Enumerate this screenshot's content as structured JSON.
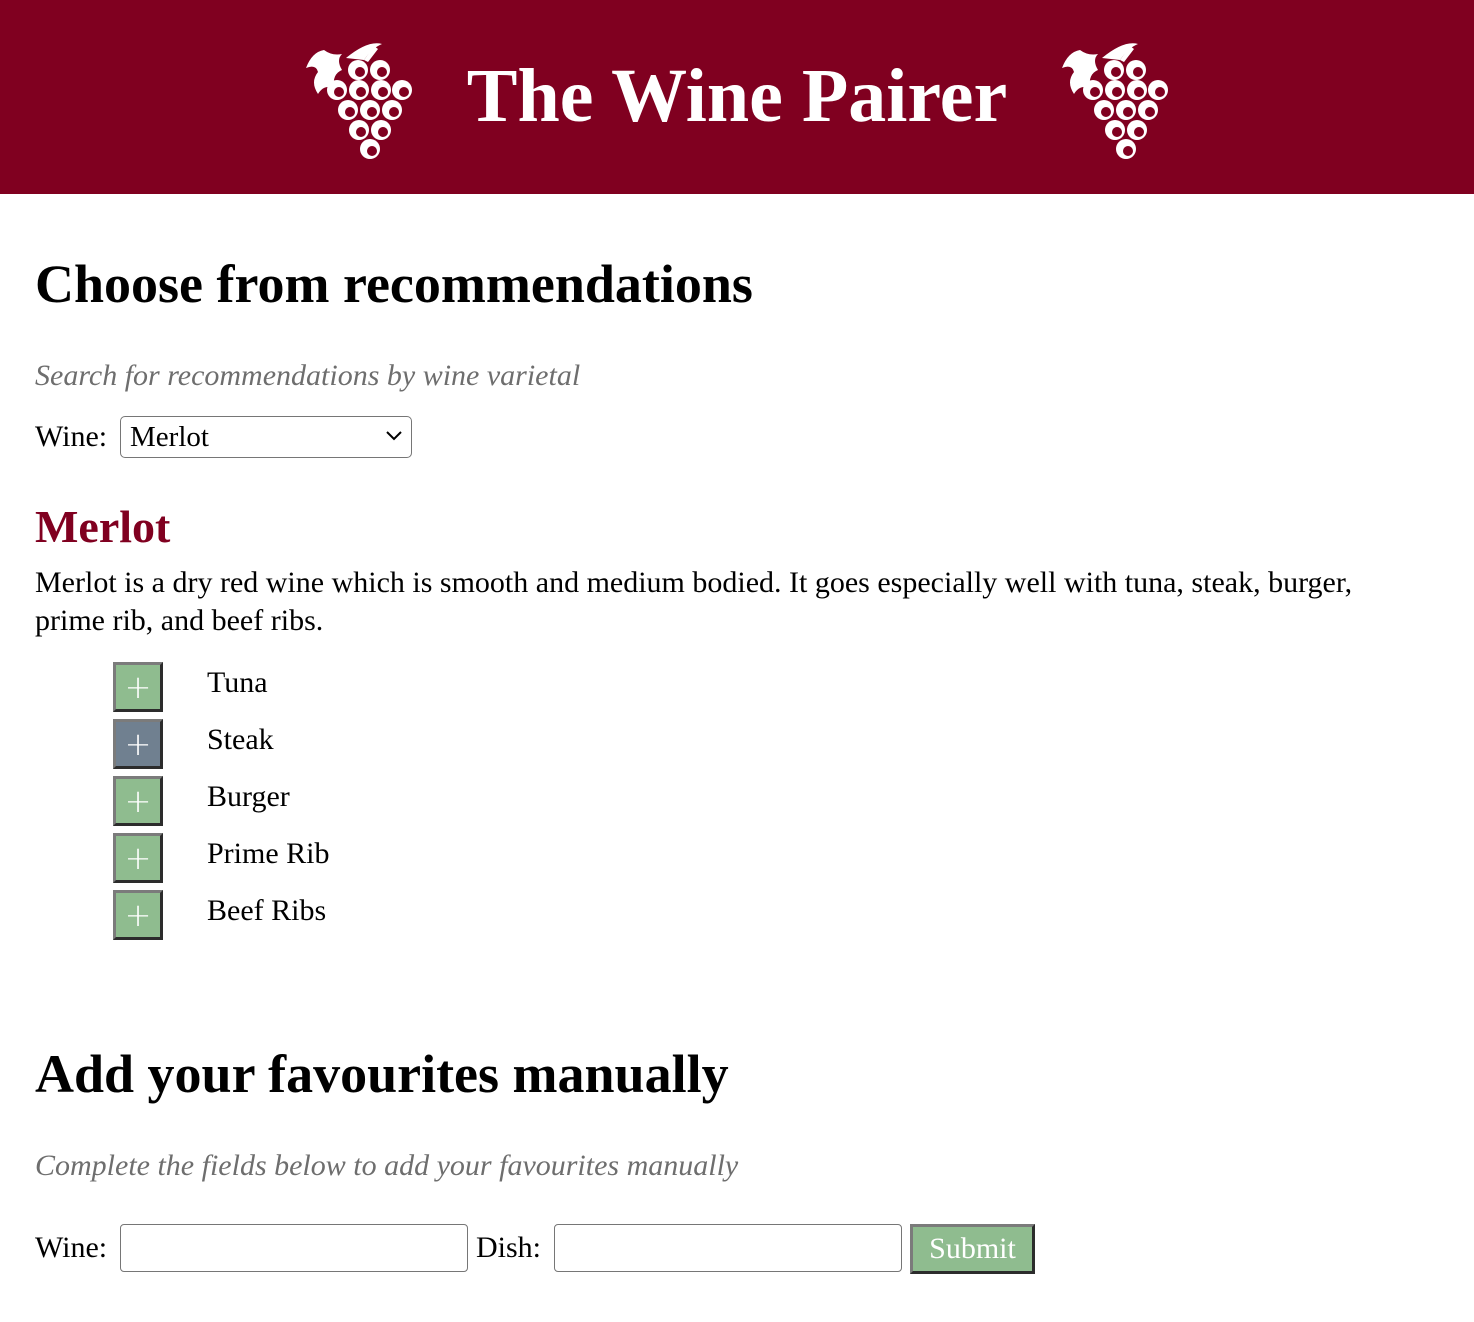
{
  "header": {
    "title": "The Wine Pairer",
    "left_icon": "grapes-icon",
    "right_icon": "grapes-icon",
    "background": "#800020"
  },
  "recommendations": {
    "title": "Choose from recommendations",
    "hint": "Search for recommendations by wine varietal",
    "wine_label": "Wine:",
    "selected_wine": "Merlot",
    "wine_heading": "Merlot",
    "description": "Merlot is a dry red wine which is smooth and medium bodied. It goes especially well with tuna, steak, burger, prime rib, and beef ribs.",
    "add_button_symbol": "+",
    "pairings": [
      {
        "label": "Tuna",
        "state": "default"
      },
      {
        "label": "Steak",
        "state": "active"
      },
      {
        "label": "Burger",
        "state": "default"
      },
      {
        "label": "Prime Rib",
        "state": "default"
      },
      {
        "label": "Beef Ribs",
        "state": "default"
      }
    ]
  },
  "manual": {
    "title": "Add your favourites manually",
    "hint": "Complete the fields below to add your favourites manually",
    "wine_label": "Wine:",
    "wine_value": "",
    "dish_label": "Dish:",
    "dish_value": "",
    "submit_label": "Submit"
  },
  "colors": {
    "accent": "#800020",
    "button_green": "#8fbc8f",
    "button_active": "#708090",
    "hint_gray": "#6e6e6e"
  }
}
